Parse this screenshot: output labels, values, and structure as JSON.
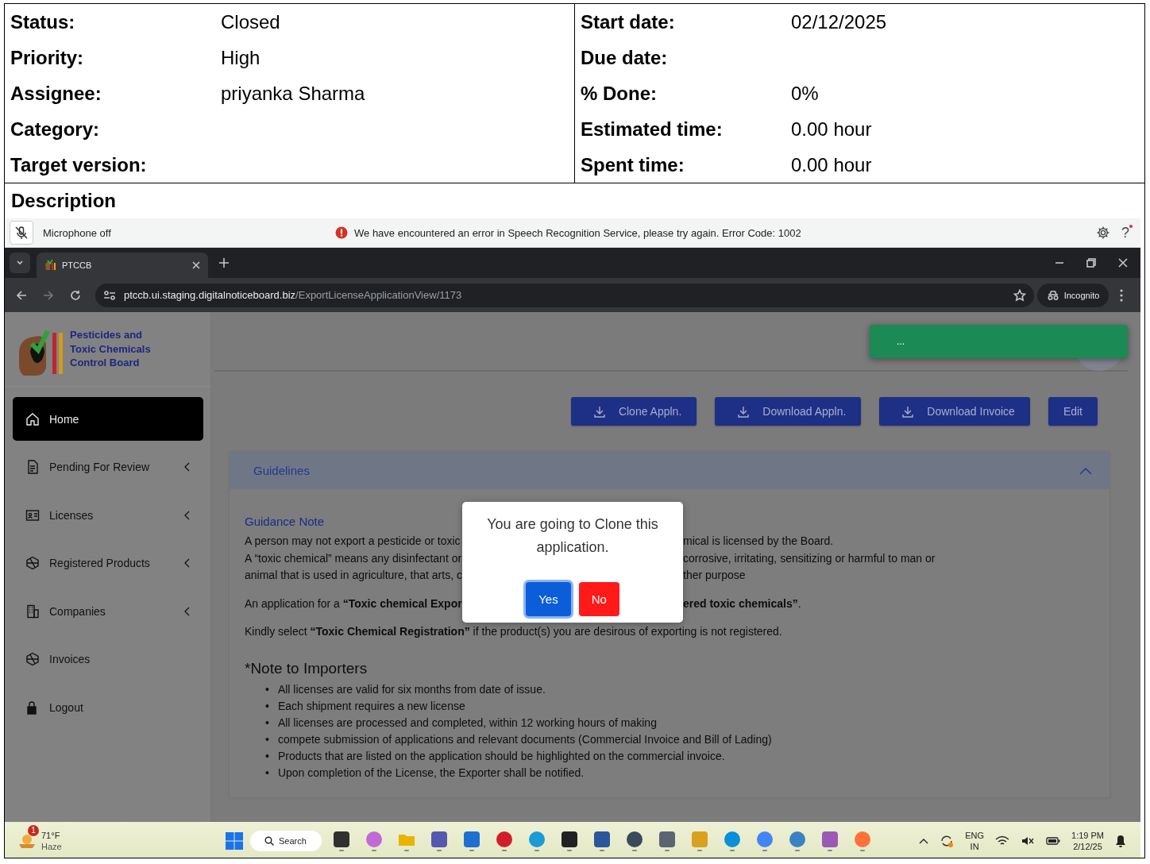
{
  "issue": {
    "left": [
      {
        "label": "Status:",
        "value": "Closed"
      },
      {
        "label": "Priority:",
        "value": "High"
      },
      {
        "label": "Assignee:",
        "value": "priyanka Sharma"
      },
      {
        "label": "Category:"
      },
      {
        "label": "Target version:"
      }
    ],
    "right": [
      {
        "label": "Start date:",
        "value": "02/12/2025"
      },
      {
        "label": "Due date:"
      },
      {
        "label": "% Done:",
        "value": "0%"
      },
      {
        "label": "Estimated time:",
        "value": "0.00 hour"
      },
      {
        "label": "Spent time:",
        "value": "0.00 hour"
      }
    ]
  },
  "description": {
    "heading": "Description",
    "screenshot": {
      "speech_bar": {
        "mic_status": "Microphone off",
        "error": "We have encountered an error in Speech Recognition Service, please try again. Error Code: 1002",
        "help": "?"
      },
      "browser": {
        "tab_title": "PTCCB",
        "url_host": "ptccb.ui.staging.digitalnoticeboard.biz",
        "url_path": "/ExportLicenseApplicationView/1173",
        "profile": "Incognito"
      },
      "app": {
        "logo_lines": [
          "Pesticides and",
          "Toxic Chemicals",
          "Control Board"
        ],
        "nav": [
          {
            "label": "Home",
            "selected": true,
            "submenu": false
          },
          {
            "label": "Pending For Review",
            "selected": false,
            "submenu": true
          },
          {
            "label": "Licenses",
            "selected": false,
            "submenu": true
          },
          {
            "label": "Registered Products",
            "selected": false,
            "submenu": true
          },
          {
            "label": "Companies",
            "selected": false,
            "submenu": true
          },
          {
            "label": "Invoices",
            "selected": false,
            "submenu": false
          },
          {
            "label": "Logout",
            "selected": false,
            "submenu": false
          }
        ],
        "toast": "...",
        "actions": [
          {
            "label": "Clone Appln.",
            "kind": "download"
          },
          {
            "label": "Download Appln.",
            "kind": "download"
          },
          {
            "label": "Download Invoice",
            "kind": "download"
          },
          {
            "label": "Edit",
            "kind": "plain"
          }
        ],
        "guidelines": {
          "title": "Guidelines",
          "expanded": true,
          "note_title": "Guidance Note",
          "paragraphs": [
            [
              {
                "left": "A person may not export a pesticide or toxic",
                "right": "mical is licensed by the Board."
              },
              {
                "left": "A “toxic chemical” means any disinfectant or",
                "right": "corrosive, irritating, sensitizing or harmful to man or"
              },
              {
                "left": "animal that is used in agriculture, that arts, c",
                "right": "ther purpose"
              }
            ],
            [
              {
                "left": "An application for a **“Toxic chemical Expor**",
                "right": "**ered toxic chemicals”**."
              }
            ]
          ],
          "closing": "Kindly select **“Toxic Chemical Registration”** if the product(s) you are desirous of exporting is not registered.",
          "notes_heading": "*Note to Importers",
          "marker": "•",
          "notes": [
            "All licenses are valid for six months from date of issue.",
            "Each shipment requires a new license",
            "All licenses are processed and completed, within 12 working hours of making",
            "compete submission of applications and relevant documents (Commercial Invoice and Bill of Lading)",
            "Products that are listed on the application should be highlighted on the commercial invoice.",
            "Upon completion of the License, the Exporter shall be notified."
          ]
        },
        "dialog": {
          "message": "You are going to Clone this application.",
          "buttons": [
            {
              "label": "Yes",
              "kind": "confirm",
              "focused": true
            },
            {
              "label": "No",
              "kind": "cancel",
              "focused": false
            }
          ]
        }
      },
      "taskbar": {
        "weather_badge": "1",
        "temperature": "71°F",
        "condition": "Haze",
        "search": "Search",
        "language": "ENG",
        "region": "IN",
        "time": "1:19 PM",
        "date": "2/12/25"
      }
    }
  }
}
